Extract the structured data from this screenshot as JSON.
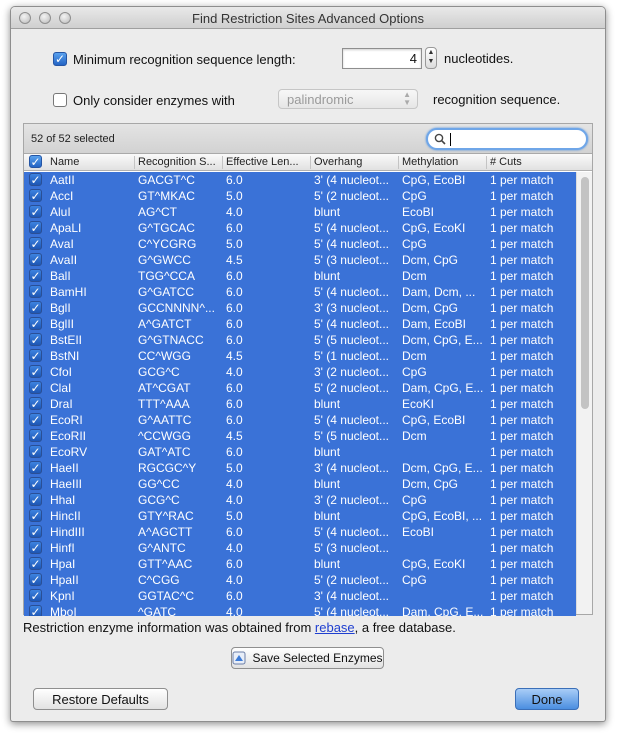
{
  "window": {
    "title": "Find Restriction Sites Advanced Options"
  },
  "options": {
    "min_length_label": "Minimum recognition sequence length:",
    "min_length_value": "4",
    "min_length_unit": "nucleotides.",
    "min_length_checked": true,
    "only_consider_label": "Only consider enzymes with",
    "only_consider_checked": false,
    "only_consider_select": "palindromic",
    "only_consider_suffix": "recognition sequence."
  },
  "table": {
    "selected_count": "52 of 52 selected",
    "search_value": "",
    "columns": [
      "Name",
      "Recognition S...",
      "Effective Len...",
      "Overhang",
      "Methylation",
      "# Cuts"
    ],
    "rows": [
      [
        "AatII",
        "GACGT^C",
        "6.0",
        "3' (4 nucleot...",
        "CpG, EcoBI",
        "1 per match"
      ],
      [
        "AccI",
        "GT^MKAC",
        "5.0",
        "5' (2 nucleot...",
        "CpG",
        "1 per match"
      ],
      [
        "AluI",
        "AG^CT",
        "4.0",
        "blunt",
        "EcoBI",
        "1 per match"
      ],
      [
        "ApaLI",
        "G^TGCAC",
        "6.0",
        "5' (4 nucleot...",
        "CpG, EcoKI",
        "1 per match"
      ],
      [
        "AvaI",
        "C^YCGRG",
        "5.0",
        "5' (4 nucleot...",
        "CpG",
        "1 per match"
      ],
      [
        "AvaII",
        "G^GWCC",
        "4.5",
        "5' (3 nucleot...",
        "Dcm, CpG",
        "1 per match"
      ],
      [
        "BalI",
        "TGG^CCA",
        "6.0",
        "blunt",
        "Dcm",
        "1 per match"
      ],
      [
        "BamHI",
        "G^GATCC",
        "6.0",
        "5' (4 nucleot...",
        "Dam, Dcm, ...",
        "1 per match"
      ],
      [
        "BglI",
        "GCCNNNN^...",
        "6.0",
        "3' (3 nucleot...",
        "Dcm, CpG",
        "1 per match"
      ],
      [
        "BglII",
        "A^GATCT",
        "6.0",
        "5' (4 nucleot...",
        "Dam, EcoBI",
        "1 per match"
      ],
      [
        "BstEII",
        "G^GTNACC",
        "6.0",
        "5' (5 nucleot...",
        "Dcm, CpG, E...",
        "1 per match"
      ],
      [
        "BstNI",
        "CC^WGG",
        "4.5",
        "5' (1 nucleot...",
        "Dcm",
        "1 per match"
      ],
      [
        "CfoI",
        "GCG^C",
        "4.0",
        "3' (2 nucleot...",
        "CpG",
        "1 per match"
      ],
      [
        "ClaI",
        "AT^CGAT",
        "6.0",
        "5' (2 nucleot...",
        "Dam, CpG, E...",
        "1 per match"
      ],
      [
        "DraI",
        "TTT^AAA",
        "6.0",
        "blunt",
        "EcoKI",
        "1 per match"
      ],
      [
        "EcoRI",
        "G^AATTC",
        "6.0",
        "5' (4 nucleot...",
        "CpG, EcoBI",
        "1 per match"
      ],
      [
        "EcoRII",
        "^CCWGG",
        "4.5",
        "5' (5 nucleot...",
        "Dcm",
        "1 per match"
      ],
      [
        "EcoRV",
        "GAT^ATC",
        "6.0",
        "blunt",
        "",
        "1 per match"
      ],
      [
        "HaeII",
        "RGCGC^Y",
        "5.0",
        "3' (4 nucleot...",
        "Dcm, CpG, E...",
        "1 per match"
      ],
      [
        "HaeIII",
        "GG^CC",
        "4.0",
        "blunt",
        "Dcm, CpG",
        "1 per match"
      ],
      [
        "HhaI",
        "GCG^C",
        "4.0",
        "3' (2 nucleot...",
        "CpG",
        "1 per match"
      ],
      [
        "HincII",
        "GTY^RAC",
        "5.0",
        "blunt",
        "CpG, EcoBI, ...",
        "1 per match"
      ],
      [
        "HindIII",
        "A^AGCTT",
        "6.0",
        "5' (4 nucleot...",
        "EcoBI",
        "1 per match"
      ],
      [
        "HinfI",
        "G^ANTC",
        "4.0",
        "5' (3 nucleot...",
        "",
        "1 per match"
      ],
      [
        "HpaI",
        "GTT^AAC",
        "6.0",
        "blunt",
        "CpG, EcoKI",
        "1 per match"
      ],
      [
        "HpaII",
        "C^CGG",
        "4.0",
        "5' (2 nucleot...",
        "CpG",
        "1 per match"
      ],
      [
        "KpnI",
        "GGTAC^C",
        "6.0",
        "3' (4 nucleot...",
        "",
        "1 per match"
      ],
      [
        "MboI",
        "^GATC",
        "4.0",
        "5' (4 nucleot...",
        "Dam, CpG, E...",
        "1 per match"
      ]
    ]
  },
  "footer": {
    "info_prefix": "Restriction enzyme information was obtained from ",
    "info_link": "rebase",
    "info_suffix": ", a free database.",
    "save_label": "Save Selected Enzymes",
    "restore_label": "Restore Defaults",
    "done_label": "Done"
  },
  "colors": {
    "selection": "#3a72d7",
    "accent": "#4b8ee0"
  }
}
